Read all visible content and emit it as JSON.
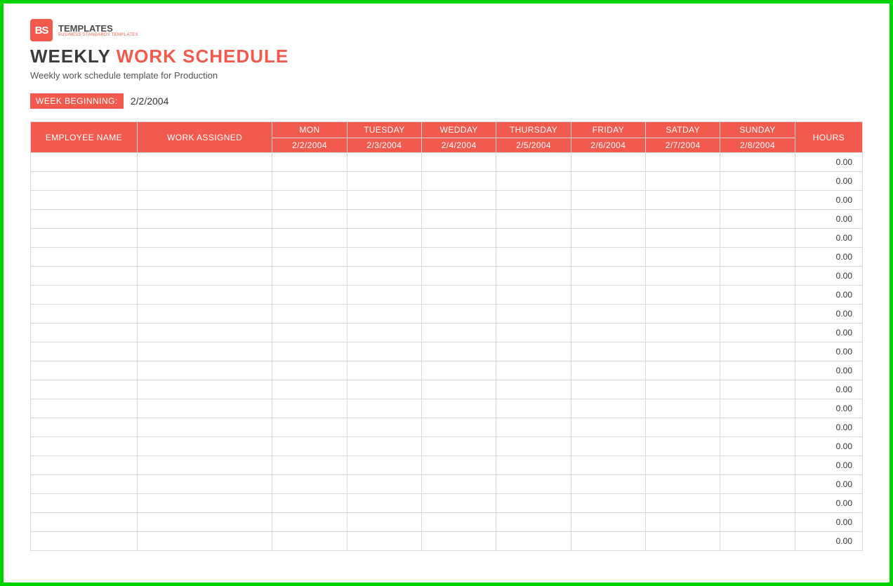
{
  "logo": {
    "badge": "BS",
    "main": "TEMPLATES",
    "sub": "BUSINESS STANDARDS TEMPLATES"
  },
  "title": {
    "part1": "WEEKLY",
    "part2": "WORK SCHEDULE"
  },
  "subtitle": "Weekly work schedule template for Production",
  "week": {
    "label": "WEEK BEGINNING:",
    "value": "2/2/2004"
  },
  "columns": {
    "employee": "EMPLOYEE NAME",
    "work": "WORK ASSIGNED",
    "hours": "HOURS",
    "days": [
      {
        "name": "MON",
        "date": "2/2/2004"
      },
      {
        "name": "TUESDAY",
        "date": "2/3/2004"
      },
      {
        "name": "WEDDAY",
        "date": "2/4/2004"
      },
      {
        "name": "THURSDAY",
        "date": "2/5/2004"
      },
      {
        "name": "FRIDAY",
        "date": "2/6/2004"
      },
      {
        "name": "SATDAY",
        "date": "2/7/2004"
      },
      {
        "name": "SUNDAY",
        "date": "2/8/2004"
      }
    ]
  },
  "rows": [
    {
      "employee": "",
      "work": "",
      "days": [
        "",
        "",
        "",
        "",
        "",
        "",
        ""
      ],
      "hours": "0.00"
    },
    {
      "employee": "",
      "work": "",
      "days": [
        "",
        "",
        "",
        "",
        "",
        "",
        ""
      ],
      "hours": "0.00"
    },
    {
      "employee": "",
      "work": "",
      "days": [
        "",
        "",
        "",
        "",
        "",
        "",
        ""
      ],
      "hours": "0.00"
    },
    {
      "employee": "",
      "work": "",
      "days": [
        "",
        "",
        "",
        "",
        "",
        "",
        ""
      ],
      "hours": "0.00"
    },
    {
      "employee": "",
      "work": "",
      "days": [
        "",
        "",
        "",
        "",
        "",
        "",
        ""
      ],
      "hours": "0.00"
    },
    {
      "employee": "",
      "work": "",
      "days": [
        "",
        "",
        "",
        "",
        "",
        "",
        ""
      ],
      "hours": "0.00"
    },
    {
      "employee": "",
      "work": "",
      "days": [
        "",
        "",
        "",
        "",
        "",
        "",
        ""
      ],
      "hours": "0.00"
    },
    {
      "employee": "",
      "work": "",
      "days": [
        "",
        "",
        "",
        "",
        "",
        "",
        ""
      ],
      "hours": "0.00"
    },
    {
      "employee": "",
      "work": "",
      "days": [
        "",
        "",
        "",
        "",
        "",
        "",
        ""
      ],
      "hours": "0.00"
    },
    {
      "employee": "",
      "work": "",
      "days": [
        "",
        "",
        "",
        "",
        "",
        "",
        ""
      ],
      "hours": "0.00"
    },
    {
      "employee": "",
      "work": "",
      "days": [
        "",
        "",
        "",
        "",
        "",
        "",
        ""
      ],
      "hours": "0.00"
    },
    {
      "employee": "",
      "work": "",
      "days": [
        "",
        "",
        "",
        "",
        "",
        "",
        ""
      ],
      "hours": "0.00"
    },
    {
      "employee": "",
      "work": "",
      "days": [
        "",
        "",
        "",
        "",
        "",
        "",
        ""
      ],
      "hours": "0.00"
    },
    {
      "employee": "",
      "work": "",
      "days": [
        "",
        "",
        "",
        "",
        "",
        "",
        ""
      ],
      "hours": "0.00"
    },
    {
      "employee": "",
      "work": "",
      "days": [
        "",
        "",
        "",
        "",
        "",
        "",
        ""
      ],
      "hours": "0.00"
    },
    {
      "employee": "",
      "work": "",
      "days": [
        "",
        "",
        "",
        "",
        "",
        "",
        ""
      ],
      "hours": "0.00"
    },
    {
      "employee": "",
      "work": "",
      "days": [
        "",
        "",
        "",
        "",
        "",
        "",
        ""
      ],
      "hours": "0.00"
    },
    {
      "employee": "",
      "work": "",
      "days": [
        "",
        "",
        "",
        "",
        "",
        "",
        ""
      ],
      "hours": "0.00"
    },
    {
      "employee": "",
      "work": "",
      "days": [
        "",
        "",
        "",
        "",
        "",
        "",
        ""
      ],
      "hours": "0.00"
    },
    {
      "employee": "",
      "work": "",
      "days": [
        "",
        "",
        "",
        "",
        "",
        "",
        ""
      ],
      "hours": "0.00"
    },
    {
      "employee": "",
      "work": "",
      "days": [
        "",
        "",
        "",
        "",
        "",
        "",
        ""
      ],
      "hours": "0.00"
    }
  ]
}
